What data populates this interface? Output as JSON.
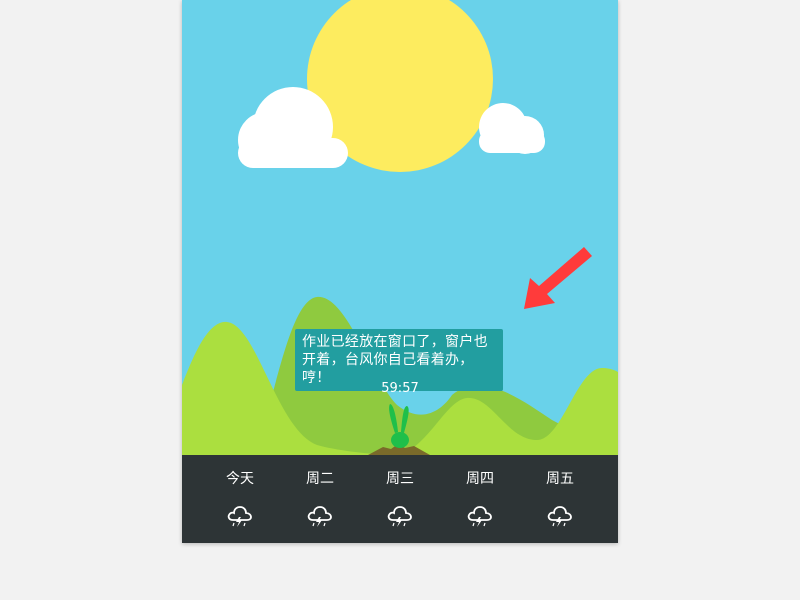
{
  "scene": {
    "speech_text": "作业已经放在窗口了，窗户也开着，台风你自己看着办，哼！",
    "timer": "59:57"
  },
  "forecast": {
    "days": [
      {
        "label": "今天",
        "icon": "thunderstorm-icon"
      },
      {
        "label": "周二",
        "icon": "thunderstorm-icon"
      },
      {
        "label": "周三",
        "icon": "thunderstorm-icon"
      },
      {
        "label": "周四",
        "icon": "thunderstorm-icon"
      },
      {
        "label": "周五",
        "icon": "thunderstorm-icon"
      }
    ]
  },
  "colors": {
    "sky": "#69d2ea",
    "sun": "#fdec5f",
    "cloud": "#ffffff",
    "hill_light": "#abdf3f",
    "hill_dark": "#8fca3f",
    "speech_bg": "#229ea0",
    "forecast_bg": "#2d3436",
    "arrow": "#ff3b3b",
    "bunny": "#1fbf4a"
  }
}
